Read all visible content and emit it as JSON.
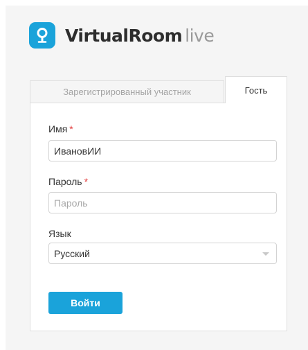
{
  "brand": {
    "name": "VirtualRoom",
    "suffix": "live",
    "icon": "location-pin-icon",
    "accent_color": "#1aa3da"
  },
  "tabs": [
    {
      "label": "Зарегистрированный участник",
      "active": false
    },
    {
      "label": "Гость",
      "active": true
    }
  ],
  "form": {
    "name": {
      "label": "Имя",
      "required_mark": "*",
      "value": "ИвановИИ",
      "placeholder": ""
    },
    "password": {
      "label": "Пароль",
      "required_mark": "*",
      "value": "",
      "placeholder": "Пароль"
    },
    "language": {
      "label": "Язык",
      "selected": "Русский"
    },
    "submit_label": "Войти"
  }
}
